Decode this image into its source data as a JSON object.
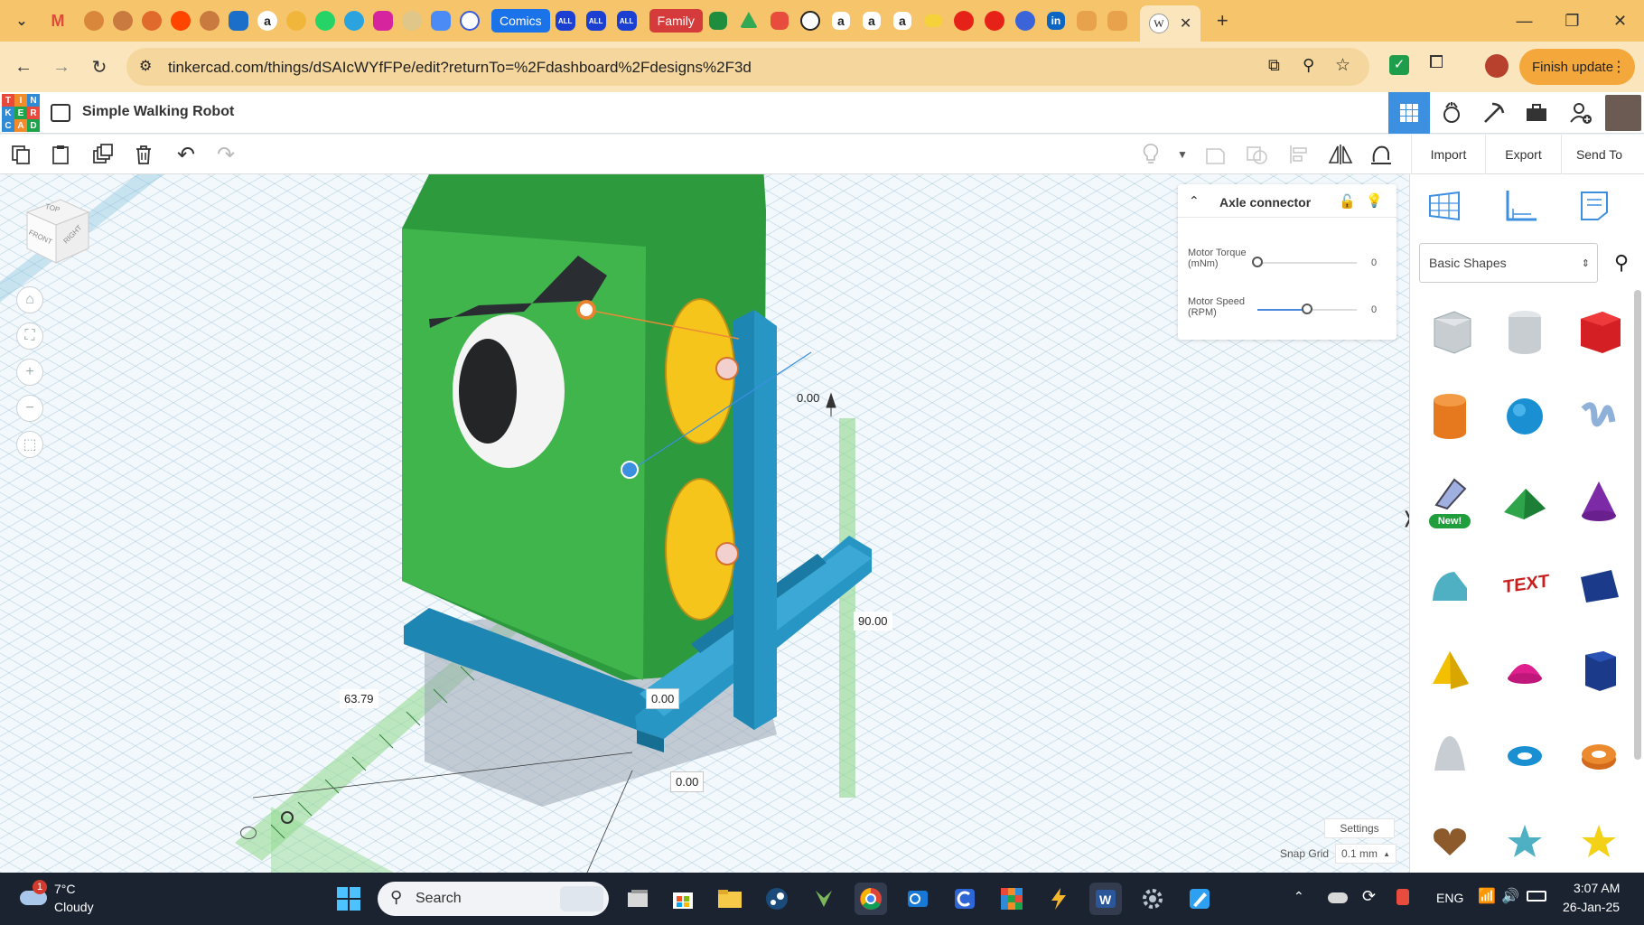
{
  "browser": {
    "tabs": [
      {
        "label": "Comics",
        "color": "#1a73e8"
      },
      {
        "label": "Family",
        "color": "#d63b3b"
      }
    ],
    "url": "tinkercad.com/things/dSAIcWYfFPe/edit?returnTo=%2Fdashboard%2Fdesigns%2F3d",
    "finish_update": "Finish update",
    "accent": "#f6c46b"
  },
  "tinkercad": {
    "design_title": "Simple Walking Robot",
    "logo_letters": [
      "T",
      "I",
      "N",
      "K",
      "E",
      "R",
      "C",
      "A",
      "D"
    ],
    "toolbar": {
      "import": "Import",
      "export": "Export",
      "send_to": "Send To"
    },
    "viewcube": {
      "top": "TOP",
      "front": "FRONT",
      "right": "RIGHT"
    }
  },
  "inspector": {
    "title": "Axle connector",
    "motor_torque_label": "Motor Torque (mNm)",
    "motor_torque_value": "0",
    "motor_torque_level": 0.0,
    "motor_speed_label": "Motor Speed (RPM)",
    "motor_speed_value": "0",
    "motor_speed_level": 0.5
  },
  "dimensions": {
    "d1": "0.00",
    "d2": "90.00",
    "d3": "63.79",
    "d4": "0.00",
    "d5": "0.00"
  },
  "shapes_panel": {
    "library": "Basic Shapes",
    "new_badge": "New!"
  },
  "footer": {
    "settings": "Settings",
    "snap_grid_label": "Snap Grid",
    "snap_grid_value": "0.1 mm"
  },
  "taskbar": {
    "weather_temp": "7°C",
    "weather_desc": "Cloudy",
    "weather_badge": "1",
    "search_placeholder": "Search",
    "language": "ENG",
    "time": "3:07 AM",
    "date": "26-Jan-25"
  }
}
